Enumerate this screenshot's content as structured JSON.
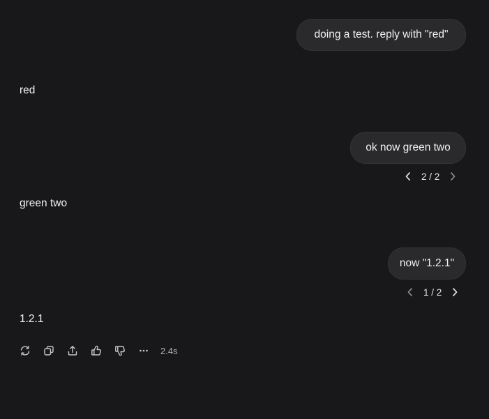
{
  "conversation": {
    "user_1": "doing a test. reply with \"red\"",
    "reply_1": "red",
    "user_2": "ok now green two",
    "pager_2": "2 / 2",
    "reply_2": "green two",
    "user_3": "now \"1.2.1\"",
    "pager_3": "1 / 2",
    "reply_3": "1.2.1"
  },
  "toolbar": {
    "icons": [
      "regenerate-icon",
      "copy-icon",
      "share-icon",
      "thumbs-up-icon",
      "thumbs-down-icon",
      "more-icon"
    ],
    "timing": "2.4s"
  },
  "colors": {
    "background": "#18181b",
    "bubble": "#2a2a2d",
    "text": "#ececec"
  }
}
